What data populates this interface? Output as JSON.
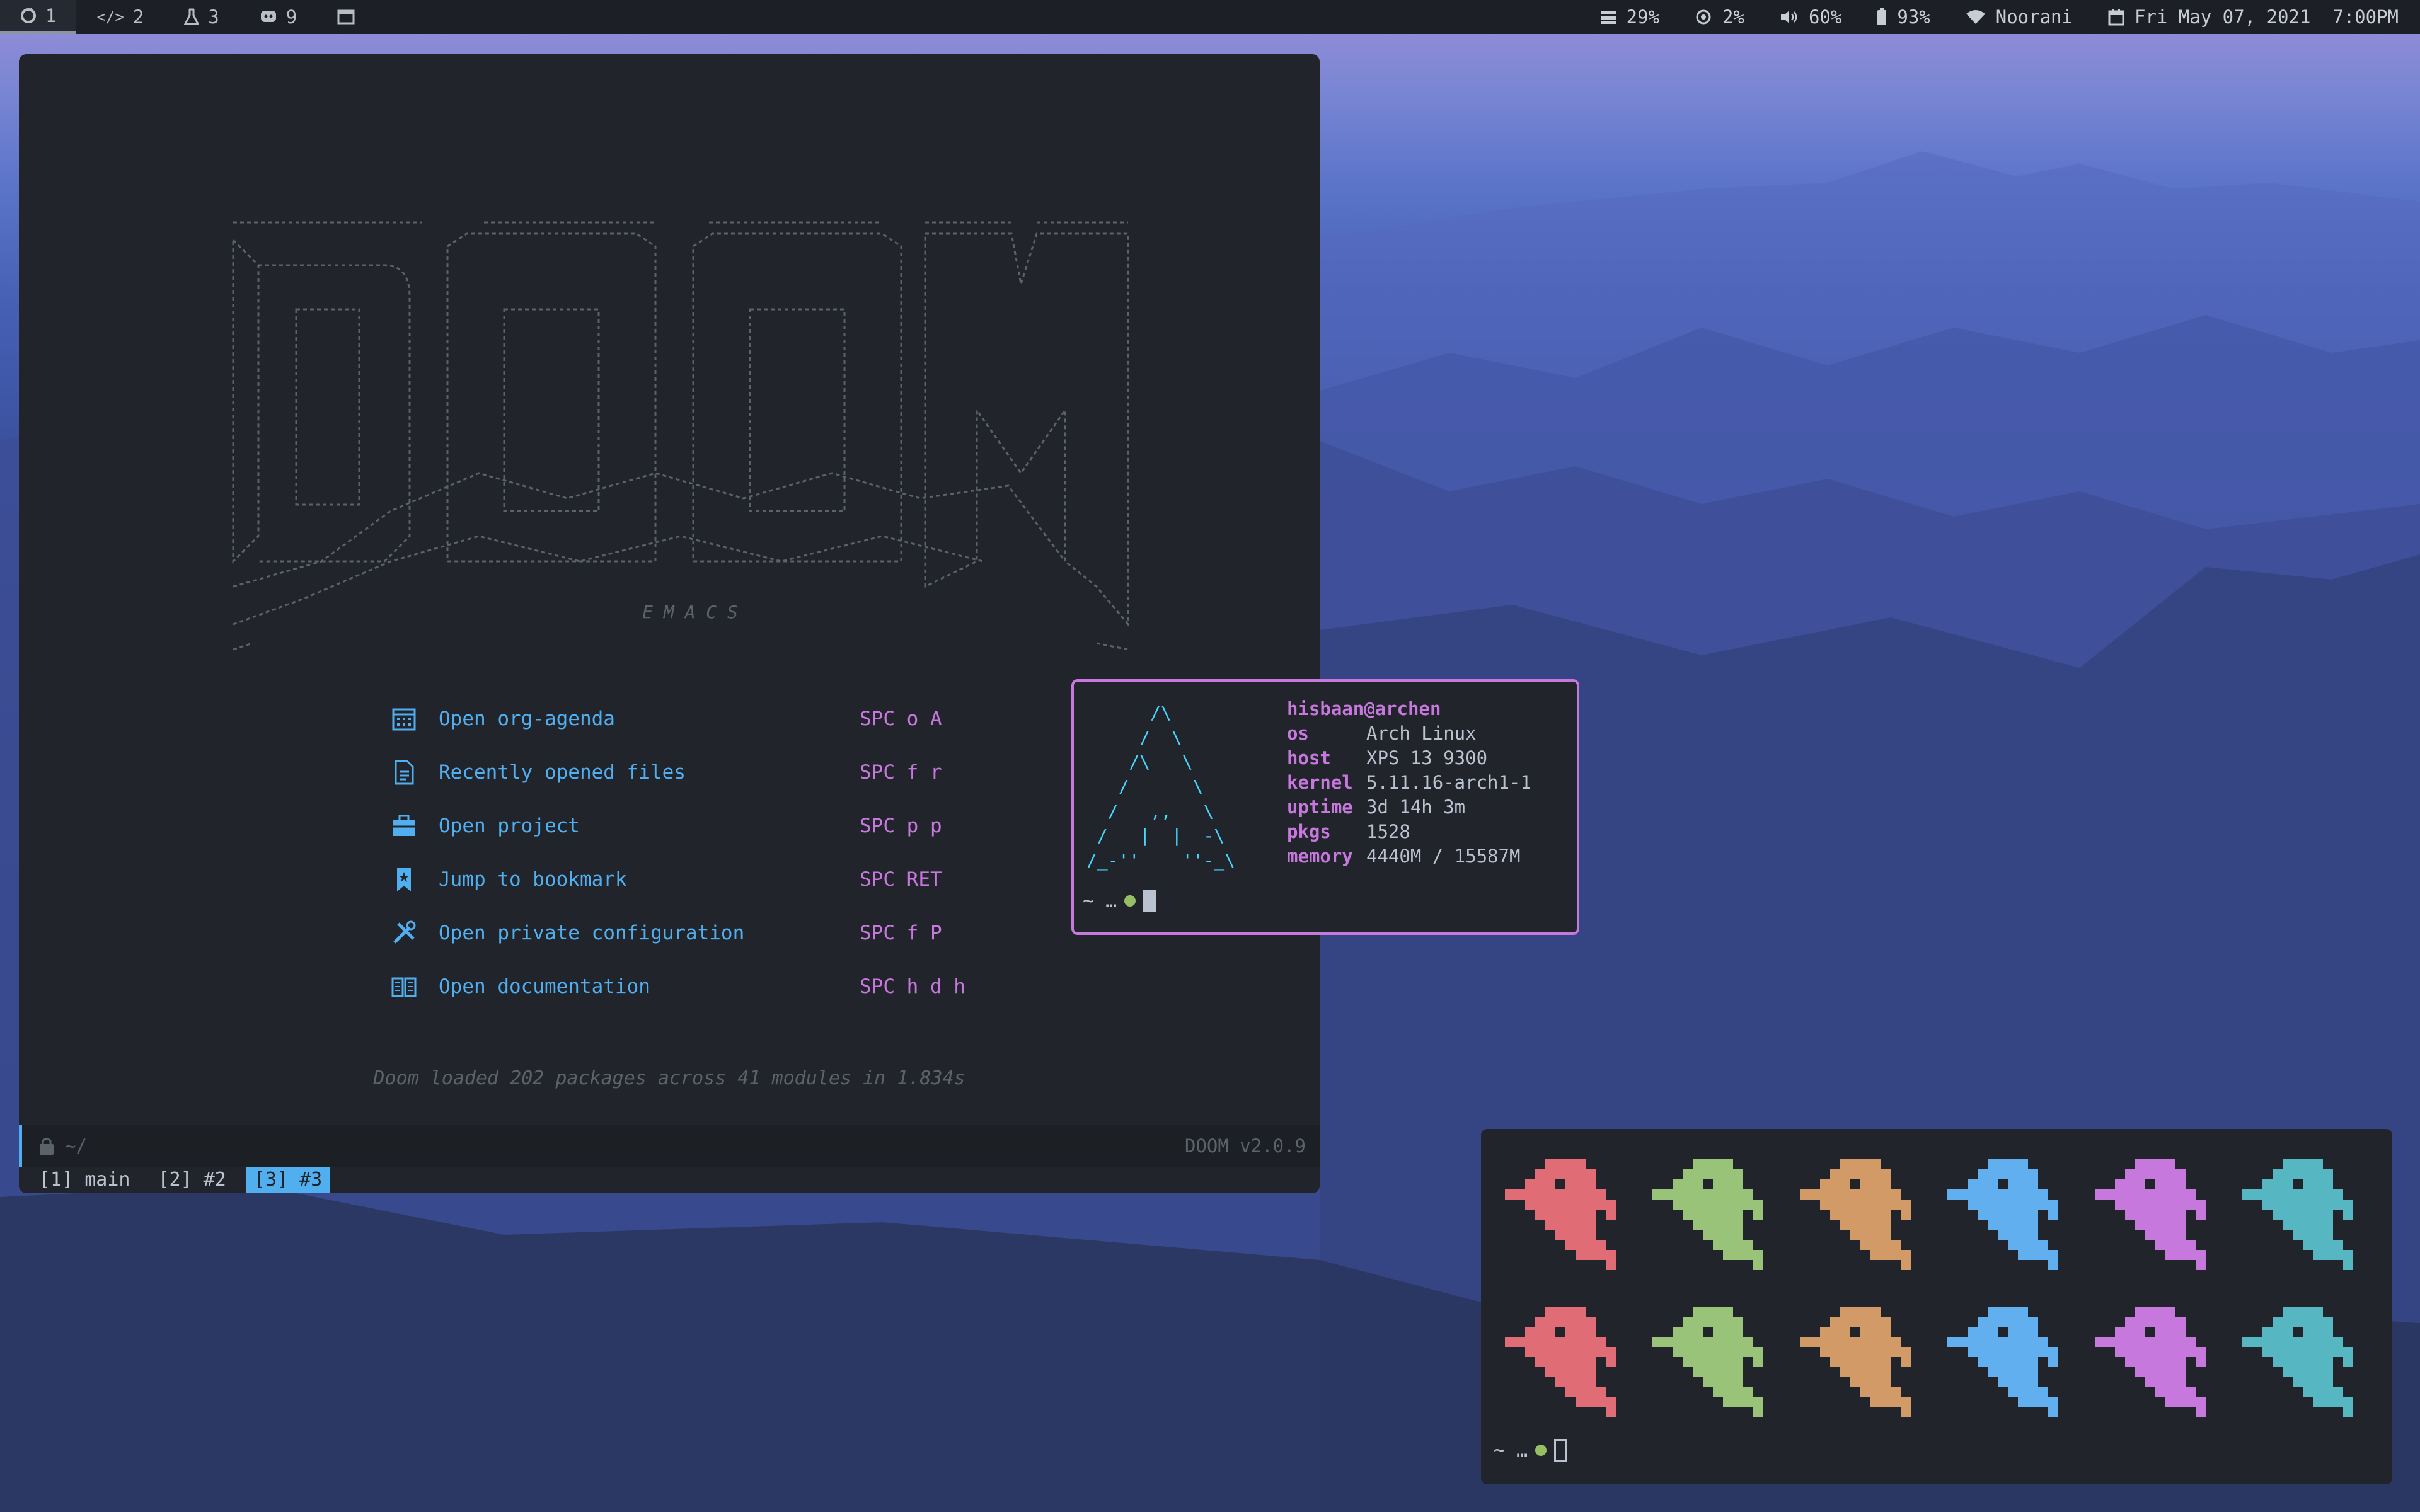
{
  "topbar": {
    "workspaces": [
      {
        "icon": "refresh-icon",
        "label": "1"
      },
      {
        "icon": "code-icon",
        "label": "2"
      },
      {
        "icon": "flask-icon",
        "label": "3"
      },
      {
        "icon": "discord-icon",
        "label": "9"
      },
      {
        "icon": "window-icon",
        "label": ""
      }
    ],
    "status": {
      "disk": "29%",
      "cpu": "2%",
      "volume": "60%",
      "battery": "93%",
      "wifi": "Noorani",
      "datetime": "Fri May 07, 2021  7:00PM"
    }
  },
  "emacs": {
    "logo_subtitle": "E M A C S",
    "menu": [
      {
        "icon": "calendar-icon",
        "label": "Open org-agenda",
        "key": "SPC o A"
      },
      {
        "icon": "file-icon",
        "label": "Recently opened files",
        "key": "SPC f r"
      },
      {
        "icon": "briefcase-icon",
        "label": "Open project",
        "key": "SPC p p"
      },
      {
        "icon": "bookmark-icon",
        "label": "Jump to bookmark",
        "key": "SPC RET"
      },
      {
        "icon": "tools-icon",
        "label": "Open private configuration",
        "key": "SPC f P"
      },
      {
        "icon": "book-icon",
        "label": "Open documentation",
        "key": "SPC h d h"
      }
    ],
    "loaded_text": "Doom loaded 202 packages across 41 modules in 1.834s",
    "modeline": {
      "path": "~/",
      "version": "DOOM v2.0.9"
    },
    "tabs": [
      {
        "label": "[1] main",
        "active": false
      },
      {
        "label": "[2] #2",
        "active": false
      },
      {
        "label": "[3] #3",
        "active": true
      }
    ]
  },
  "neofetch": {
    "user": "hisbaan@archen",
    "fields": [
      {
        "key": "os",
        "value": "Arch Linux"
      },
      {
        "key": "host",
        "value": "XPS 13 9300"
      },
      {
        "key": "kernel",
        "value": "5.11.16-arch1-1"
      },
      {
        "key": "uptime",
        "value": "3d 14h 3m"
      },
      {
        "key": "pkgs",
        "value": "1528"
      },
      {
        "key": "memory",
        "value": "4440M / 15587M"
      }
    ],
    "prompt": "~ …"
  },
  "ghosts_terminal": {
    "colors": [
      "#e06c75",
      "#98c379",
      "#d19a66",
      "#61afef",
      "#c678dd",
      "#56b6c2"
    ],
    "prompt": "~ …"
  }
}
